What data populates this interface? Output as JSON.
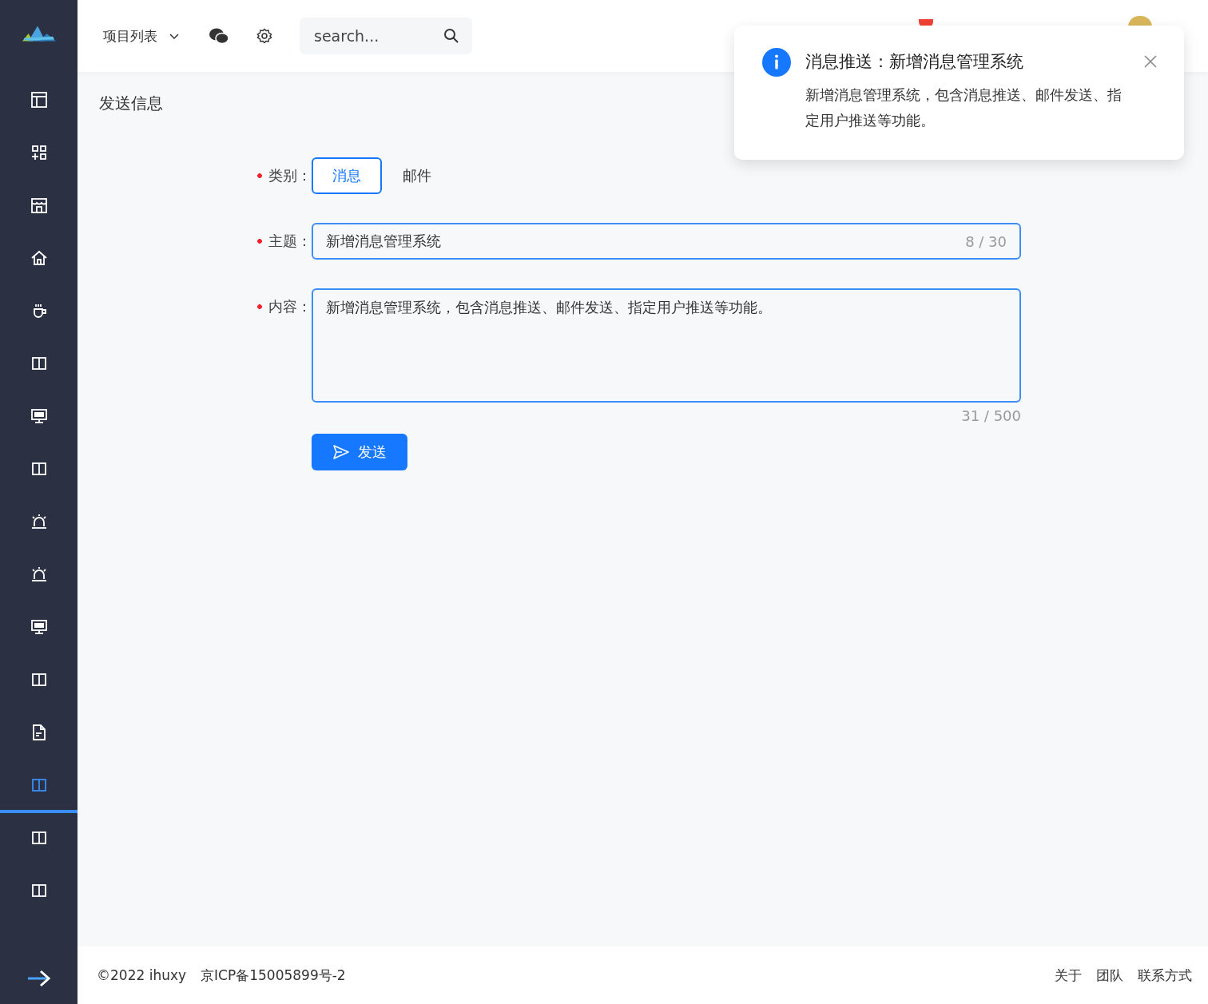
{
  "sidebar": {
    "items": [
      {
        "kind": "layout",
        "selected": false
      },
      {
        "kind": "apps",
        "selected": false
      },
      {
        "kind": "shop",
        "selected": false
      },
      {
        "kind": "home",
        "selected": false
      },
      {
        "kind": "cup",
        "selected": false
      },
      {
        "kind": "columns",
        "selected": false
      },
      {
        "kind": "sql",
        "selected": false
      },
      {
        "kind": "columns",
        "selected": false
      },
      {
        "kind": "alarm",
        "selected": false
      },
      {
        "kind": "alarm",
        "selected": false
      },
      {
        "kind": "sql",
        "selected": false
      },
      {
        "kind": "columns",
        "selected": false
      },
      {
        "kind": "file",
        "selected": false
      },
      {
        "kind": "columns",
        "selected": true
      },
      {
        "kind": "columns",
        "selected": false
      },
      {
        "kind": "columns",
        "selected": false
      }
    ]
  },
  "header": {
    "project_menu": "项目列表",
    "search": {
      "placeholder": "search..."
    }
  },
  "page": {
    "title": "发送信息"
  },
  "form": {
    "fields": [
      {
        "kind": "radio",
        "label": "类别：",
        "required": true,
        "options": [
          {
            "label": "消息",
            "selected": true
          },
          {
            "label": "邮件",
            "selected": false
          }
        ]
      },
      {
        "kind": "input",
        "label": "主题：",
        "required": true,
        "value": "新增消息管理系统",
        "count": "8 / 30"
      },
      {
        "kind": "textarea",
        "label": "内容：",
        "required": true,
        "value": "新增消息管理系统，包含消息推送、邮件发送、指定用户推送等功能。",
        "count": "31 / 500"
      }
    ],
    "submit": "发送"
  },
  "notification": {
    "title": "消息推送：新增消息管理系统",
    "body": "新增消息管理系统，包含消息推送、邮件发送、指定用户推送等功能。"
  },
  "footer": {
    "copyright": "©2022 ihuxy",
    "icp": "京ICP备15005899号-2",
    "links": [
      "关于",
      "团队",
      "联系方式"
    ]
  }
}
